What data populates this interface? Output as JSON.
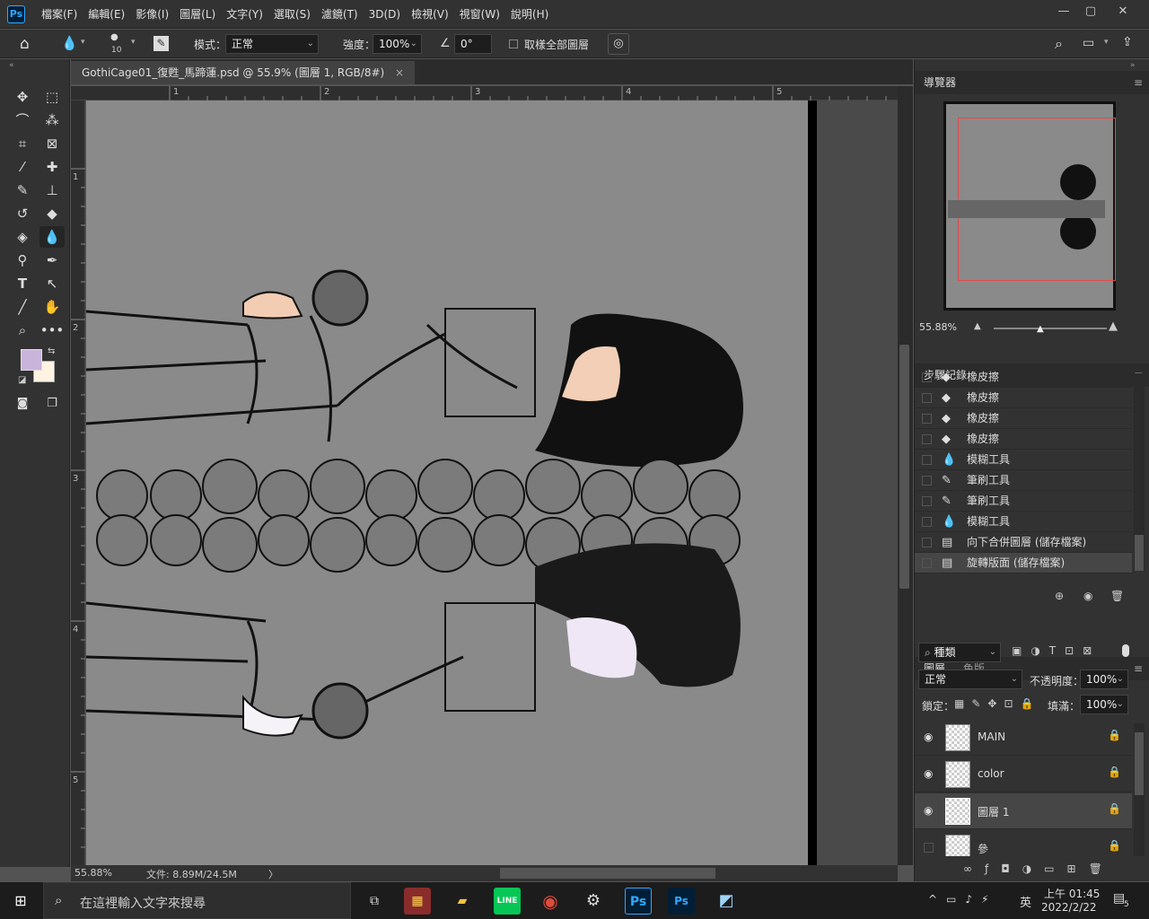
{
  "menubar": {
    "logo": "Ps",
    "items": [
      "檔案(F)",
      "編輯(E)",
      "影像(I)",
      "圖層(L)",
      "文字(Y)",
      "選取(S)",
      "濾鏡(T)",
      "3D(D)",
      "檢視(V)",
      "視窗(W)",
      "說明(H)"
    ],
    "minimize": "—",
    "maximize": "▢",
    "close": "✕"
  },
  "options": {
    "brush_size": "10",
    "mode_label": "模式：",
    "mode_value": "正常",
    "strength_label": "強度：",
    "strength_value": "100%",
    "angle_value": "0°",
    "sample_all_label": "取樣全部圖層"
  },
  "document": {
    "tab_title": "GothiCage01_復甦_馬蹄蓮.psd @ 55.9% (圖層 1, RGB/8#)",
    "close": "×"
  },
  "ruler": {
    "top": [
      "1",
      "2",
      "3",
      "4",
      "5"
    ],
    "left": [
      "1",
      "2",
      "3",
      "4",
      "5"
    ]
  },
  "status": {
    "zoom": "55.88%",
    "doc_info": "文件: 8.89M/24.5M",
    "arrow": "〉"
  },
  "navigator": {
    "title": "導覽器",
    "zoom": "55.88%"
  },
  "history": {
    "title": "步驟記錄",
    "items": [
      {
        "icon": "eraser-icon",
        "glyph": "◆",
        "label": "橡皮擦"
      },
      {
        "icon": "eraser-icon",
        "glyph": "◆",
        "label": "橡皮擦"
      },
      {
        "icon": "eraser-icon",
        "glyph": "◆",
        "label": "橡皮擦"
      },
      {
        "icon": "eraser-icon",
        "glyph": "◆",
        "label": "橡皮擦"
      },
      {
        "icon": "blur-icon",
        "glyph": "💧",
        "label": "模糊工具"
      },
      {
        "icon": "brush-icon",
        "glyph": "✎",
        "label": "筆刷工具"
      },
      {
        "icon": "brush-icon",
        "glyph": "✎",
        "label": "筆刷工具"
      },
      {
        "icon": "blur-icon",
        "glyph": "💧",
        "label": "模糊工具"
      },
      {
        "icon": "document-icon",
        "glyph": "▤",
        "label": "向下合併圖層 (儲存檔案)"
      },
      {
        "icon": "document-icon",
        "glyph": "▤",
        "label": "旋轉版面 (儲存檔案)"
      }
    ]
  },
  "layers": {
    "tab_layers": "圖層",
    "tab_channels": "色版",
    "filter_label": "種類",
    "blend_mode": "正常",
    "opacity_label": "不透明度：",
    "opacity_value": "100%",
    "lock_label": "鎖定：",
    "fill_label": "填滿：",
    "fill_value": "100%",
    "items": [
      {
        "name": "MAIN",
        "visible": true
      },
      {
        "name": "color",
        "visible": true
      },
      {
        "name": "圖層 1",
        "visible": true,
        "selected": true
      },
      {
        "name": "參",
        "visible": false
      }
    ]
  },
  "taskbar": {
    "search_placeholder": "在這裡輸入文字來搜尋",
    "ime": "英",
    "time": "上午 01:45",
    "date": "2022/2/22",
    "notif_count": "5"
  },
  "colors": {
    "foreground": "#c9b4dc",
    "background": "#fff3e2",
    "accent": "#31a8ff"
  }
}
